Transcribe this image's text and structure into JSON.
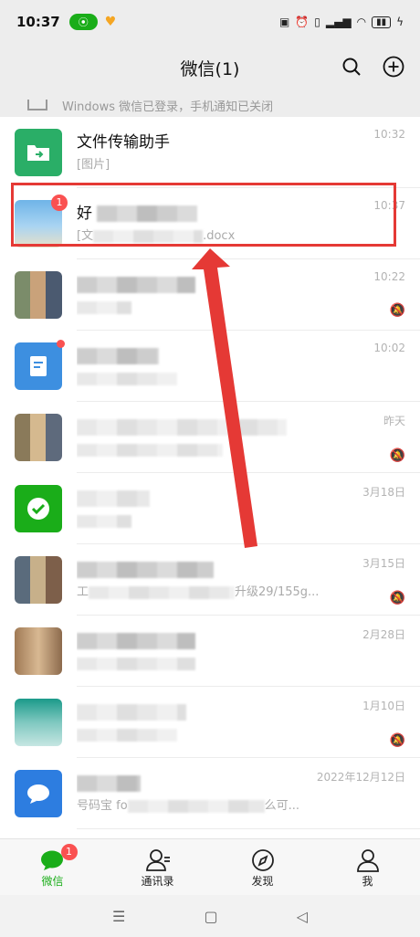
{
  "status_bar": {
    "time": "10:37"
  },
  "header": {
    "title": "微信(1)"
  },
  "notice": {
    "text": "Windows 微信已登录，手机通知已关闭"
  },
  "chats": [
    {
      "name": "文件传输助手",
      "preview": "[图片]",
      "time": "10:32"
    },
    {
      "name_visible": "好",
      "preview_start": "[文",
      "preview_end": ".docx",
      "time": "10:37",
      "badge": "1"
    },
    {
      "time": "10:22"
    },
    {
      "time": "10:02"
    },
    {
      "time": "昨天"
    },
    {
      "time": "3月18日"
    },
    {
      "time": "3月15日",
      "preview_start": "工",
      "preview_end": "升级29/155g..."
    },
    {
      "time": "2月28日"
    },
    {
      "time": "1月10日"
    },
    {
      "time": "2022年12月12日",
      "preview_start": "号码宝 fo",
      "preview_end": "么可..."
    }
  ],
  "tabs": [
    {
      "label": "微信",
      "badge": "1"
    },
    {
      "label": "通讯录"
    },
    {
      "label": "发现"
    },
    {
      "label": "我"
    }
  ],
  "colors": {
    "brand_green": "#1aad19",
    "badge_red": "#fa5151",
    "annotation_red": "#e53935"
  }
}
